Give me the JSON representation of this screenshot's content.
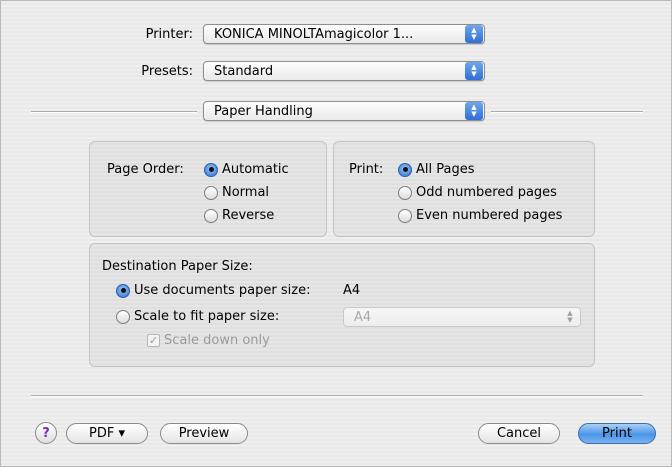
{
  "header": {
    "printer_label": "Printer:",
    "printer_value": "KONICA MINOLTAmagicolor 1...",
    "presets_label": "Presets:",
    "presets_value": "Standard",
    "panel_value": "Paper Handling"
  },
  "page_order": {
    "label": "Page Order:",
    "options": [
      "Automatic",
      "Normal",
      "Reverse"
    ],
    "selected": "Automatic"
  },
  "print_range": {
    "label": "Print:",
    "options": [
      "All Pages",
      "Odd numbered pages",
      "Even numbered pages"
    ],
    "selected": "All Pages"
  },
  "destination": {
    "title": "Destination Paper Size:",
    "use_documents_label": "Use documents paper size:",
    "use_documents_value": "A4",
    "scale_label": "Scale to fit paper size:",
    "scale_value": "A4",
    "scale_down_label": "Scale down only",
    "selected": "use_documents"
  },
  "footer": {
    "help_symbol": "?",
    "pdf_label": "PDF ▾",
    "preview_label": "Preview",
    "cancel_label": "Cancel",
    "print_label": "Print"
  },
  "colors": {
    "accent": "#3b82e0",
    "background": "#ededed"
  }
}
